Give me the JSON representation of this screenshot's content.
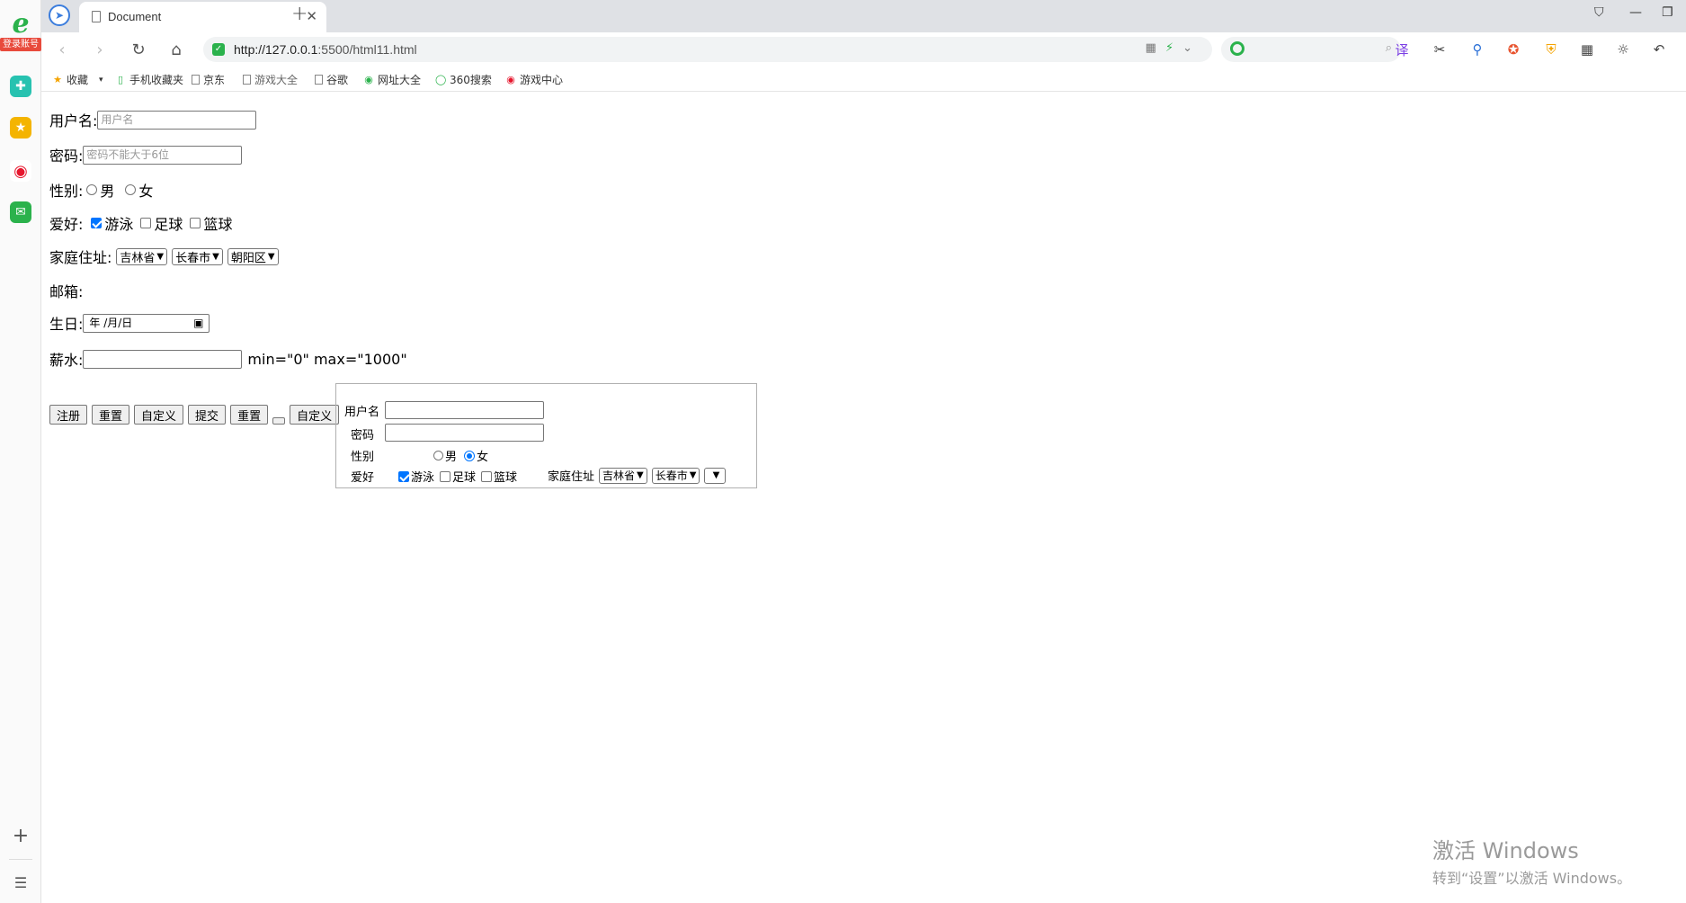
{
  "sidebar": {
    "login_badge": "登录账号"
  },
  "tab": {
    "title": "Document"
  },
  "toolbar": {
    "url_host": "http://127.0.0.1",
    "url_rest": ":5500/html11.html"
  },
  "bookmarks": [
    {
      "label": "收藏",
      "icon": "star-icon"
    },
    {
      "label": "手机收藏夹",
      "icon": "phone-icon"
    },
    {
      "label": "京东",
      "icon": "page-icon"
    },
    {
      "label": "游戏大全",
      "icon": "page-icon"
    },
    {
      "label": "谷歌",
      "icon": "page-icon"
    },
    {
      "label": "网址大全",
      "icon": "globe-icon"
    },
    {
      "label": "360搜索",
      "icon": "search-360-icon"
    },
    {
      "label": "游戏中心",
      "icon": "game-center-icon"
    }
  ],
  "form": {
    "username_label": "用户名:",
    "username_placeholder": "用户名",
    "password_label": "密码:",
    "password_placeholder": "密码不能大于6位",
    "gender_label": "性别:",
    "gender_male": "男",
    "gender_female": "女",
    "hobby_label": "爱好:",
    "hobby_swim": "游泳",
    "hobby_football": "足球",
    "hobby_basketball": "篮球",
    "address_label": "家庭住址:",
    "province": "吉林省",
    "city": "长春市",
    "district": "朝阳区",
    "email_label": "邮箱:",
    "birthday_label": "生日:",
    "birthday_value": "年 /月/日",
    "salary_label": "薪水:",
    "salary_note": "min=\"0\" max=\"1000\"",
    "buttons": [
      "注册",
      "重置",
      "自定义",
      "提交",
      "重置"
    ],
    "custom_button_2": "自定义"
  },
  "fieldset": {
    "username_label": "用户名",
    "password_label": "密码",
    "gender_label": "性别",
    "gender_male": "男",
    "gender_female": "女",
    "hobby_label": "爱好",
    "hobby_swim": "游泳",
    "hobby_football": "足球",
    "hobby_basketball": "篮球",
    "address_label": "家庭住址",
    "province": "吉林省",
    "city": "长春市",
    "district": ""
  },
  "watermark": {
    "line1": "激活 Windows",
    "line2": "转到“设置”以激活 Windows。"
  }
}
